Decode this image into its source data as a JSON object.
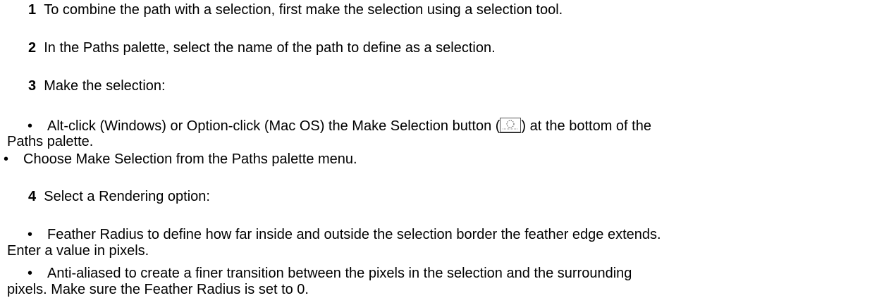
{
  "steps": [
    {
      "number": "1",
      "text": "To combine the path with a selection, first make the selection using a selection tool."
    },
    {
      "number": "2",
      "text": "In the Paths palette, select the name of the path to define as a selection."
    },
    {
      "number": "3",
      "text": "Make the selection:"
    },
    {
      "number": "4",
      "text": "Select a Rendering option:"
    }
  ],
  "bullets": {
    "bullet_char": "•",
    "alt_click_before": "Alt-click (Windows) or Option-click (Mac OS) the Make Selection button (",
    "alt_click_after": ") at the bottom of the",
    "alt_click_wrap": "Paths palette.",
    "choose_menu": "Choose Make Selection from the Paths palette menu.",
    "feather_line1": "Feather Radius to define how far inside and outside the selection border the feather edge extends.",
    "feather_line2": "Enter a value in pixels.",
    "anti_line1": "Anti-aliased to create a finer transition between the pixels in the selection and the surrounding",
    "anti_line2": "pixels. Make sure the Feather Radius is set to 0."
  },
  "icons": {
    "make_selection_button": "make-selection-icon"
  }
}
